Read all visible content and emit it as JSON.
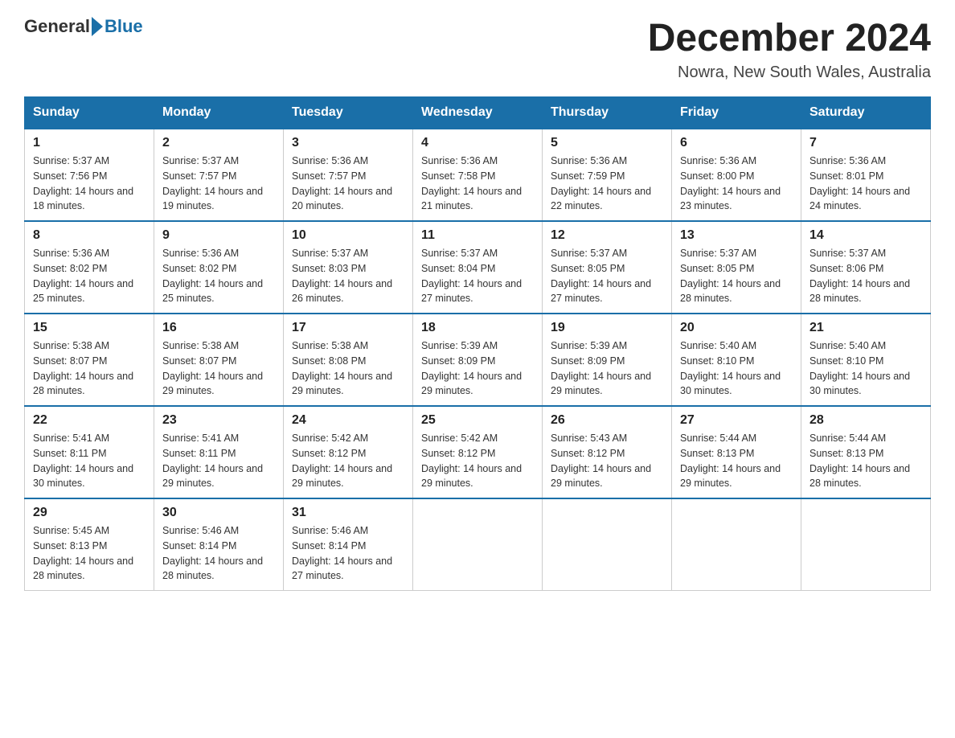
{
  "header": {
    "logo_general": "General",
    "logo_blue": "Blue",
    "title": "December 2024",
    "subtitle": "Nowra, New South Wales, Australia"
  },
  "days_of_week": [
    "Sunday",
    "Monday",
    "Tuesday",
    "Wednesday",
    "Thursday",
    "Friday",
    "Saturday"
  ],
  "weeks": [
    [
      {
        "day": "1",
        "sunrise": "Sunrise: 5:37 AM",
        "sunset": "Sunset: 7:56 PM",
        "daylight": "Daylight: 14 hours and 18 minutes."
      },
      {
        "day": "2",
        "sunrise": "Sunrise: 5:37 AM",
        "sunset": "Sunset: 7:57 PM",
        "daylight": "Daylight: 14 hours and 19 minutes."
      },
      {
        "day": "3",
        "sunrise": "Sunrise: 5:36 AM",
        "sunset": "Sunset: 7:57 PM",
        "daylight": "Daylight: 14 hours and 20 minutes."
      },
      {
        "day": "4",
        "sunrise": "Sunrise: 5:36 AM",
        "sunset": "Sunset: 7:58 PM",
        "daylight": "Daylight: 14 hours and 21 minutes."
      },
      {
        "day": "5",
        "sunrise": "Sunrise: 5:36 AM",
        "sunset": "Sunset: 7:59 PM",
        "daylight": "Daylight: 14 hours and 22 minutes."
      },
      {
        "day": "6",
        "sunrise": "Sunrise: 5:36 AM",
        "sunset": "Sunset: 8:00 PM",
        "daylight": "Daylight: 14 hours and 23 minutes."
      },
      {
        "day": "7",
        "sunrise": "Sunrise: 5:36 AM",
        "sunset": "Sunset: 8:01 PM",
        "daylight": "Daylight: 14 hours and 24 minutes."
      }
    ],
    [
      {
        "day": "8",
        "sunrise": "Sunrise: 5:36 AM",
        "sunset": "Sunset: 8:02 PM",
        "daylight": "Daylight: 14 hours and 25 minutes."
      },
      {
        "day": "9",
        "sunrise": "Sunrise: 5:36 AM",
        "sunset": "Sunset: 8:02 PM",
        "daylight": "Daylight: 14 hours and 25 minutes."
      },
      {
        "day": "10",
        "sunrise": "Sunrise: 5:37 AM",
        "sunset": "Sunset: 8:03 PM",
        "daylight": "Daylight: 14 hours and 26 minutes."
      },
      {
        "day": "11",
        "sunrise": "Sunrise: 5:37 AM",
        "sunset": "Sunset: 8:04 PM",
        "daylight": "Daylight: 14 hours and 27 minutes."
      },
      {
        "day": "12",
        "sunrise": "Sunrise: 5:37 AM",
        "sunset": "Sunset: 8:05 PM",
        "daylight": "Daylight: 14 hours and 27 minutes."
      },
      {
        "day": "13",
        "sunrise": "Sunrise: 5:37 AM",
        "sunset": "Sunset: 8:05 PM",
        "daylight": "Daylight: 14 hours and 28 minutes."
      },
      {
        "day": "14",
        "sunrise": "Sunrise: 5:37 AM",
        "sunset": "Sunset: 8:06 PM",
        "daylight": "Daylight: 14 hours and 28 minutes."
      }
    ],
    [
      {
        "day": "15",
        "sunrise": "Sunrise: 5:38 AM",
        "sunset": "Sunset: 8:07 PM",
        "daylight": "Daylight: 14 hours and 28 minutes."
      },
      {
        "day": "16",
        "sunrise": "Sunrise: 5:38 AM",
        "sunset": "Sunset: 8:07 PM",
        "daylight": "Daylight: 14 hours and 29 minutes."
      },
      {
        "day": "17",
        "sunrise": "Sunrise: 5:38 AM",
        "sunset": "Sunset: 8:08 PM",
        "daylight": "Daylight: 14 hours and 29 minutes."
      },
      {
        "day": "18",
        "sunrise": "Sunrise: 5:39 AM",
        "sunset": "Sunset: 8:09 PM",
        "daylight": "Daylight: 14 hours and 29 minutes."
      },
      {
        "day": "19",
        "sunrise": "Sunrise: 5:39 AM",
        "sunset": "Sunset: 8:09 PM",
        "daylight": "Daylight: 14 hours and 29 minutes."
      },
      {
        "day": "20",
        "sunrise": "Sunrise: 5:40 AM",
        "sunset": "Sunset: 8:10 PM",
        "daylight": "Daylight: 14 hours and 30 minutes."
      },
      {
        "day": "21",
        "sunrise": "Sunrise: 5:40 AM",
        "sunset": "Sunset: 8:10 PM",
        "daylight": "Daylight: 14 hours and 30 minutes."
      }
    ],
    [
      {
        "day": "22",
        "sunrise": "Sunrise: 5:41 AM",
        "sunset": "Sunset: 8:11 PM",
        "daylight": "Daylight: 14 hours and 30 minutes."
      },
      {
        "day": "23",
        "sunrise": "Sunrise: 5:41 AM",
        "sunset": "Sunset: 8:11 PM",
        "daylight": "Daylight: 14 hours and 29 minutes."
      },
      {
        "day": "24",
        "sunrise": "Sunrise: 5:42 AM",
        "sunset": "Sunset: 8:12 PM",
        "daylight": "Daylight: 14 hours and 29 minutes."
      },
      {
        "day": "25",
        "sunrise": "Sunrise: 5:42 AM",
        "sunset": "Sunset: 8:12 PM",
        "daylight": "Daylight: 14 hours and 29 minutes."
      },
      {
        "day": "26",
        "sunrise": "Sunrise: 5:43 AM",
        "sunset": "Sunset: 8:12 PM",
        "daylight": "Daylight: 14 hours and 29 minutes."
      },
      {
        "day": "27",
        "sunrise": "Sunrise: 5:44 AM",
        "sunset": "Sunset: 8:13 PM",
        "daylight": "Daylight: 14 hours and 29 minutes."
      },
      {
        "day": "28",
        "sunrise": "Sunrise: 5:44 AM",
        "sunset": "Sunset: 8:13 PM",
        "daylight": "Daylight: 14 hours and 28 minutes."
      }
    ],
    [
      {
        "day": "29",
        "sunrise": "Sunrise: 5:45 AM",
        "sunset": "Sunset: 8:13 PM",
        "daylight": "Daylight: 14 hours and 28 minutes."
      },
      {
        "day": "30",
        "sunrise": "Sunrise: 5:46 AM",
        "sunset": "Sunset: 8:14 PM",
        "daylight": "Daylight: 14 hours and 28 minutes."
      },
      {
        "day": "31",
        "sunrise": "Sunrise: 5:46 AM",
        "sunset": "Sunset: 8:14 PM",
        "daylight": "Daylight: 14 hours and 27 minutes."
      },
      null,
      null,
      null,
      null
    ]
  ]
}
